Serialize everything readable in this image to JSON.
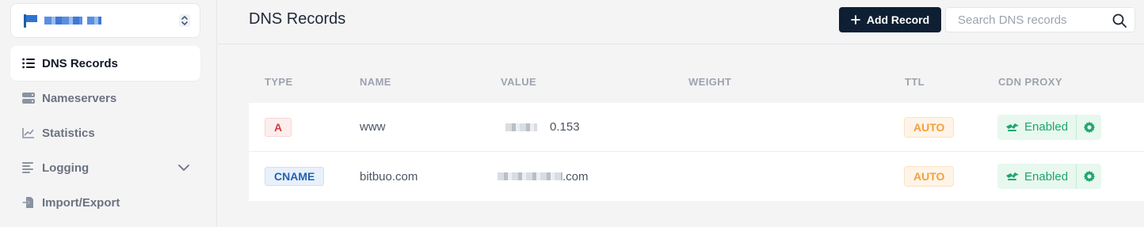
{
  "sidebar": {
    "site_selector": {
      "icon": "flag-icon"
    },
    "items": [
      {
        "label": "DNS Records",
        "icon": "list-icon",
        "active": true
      },
      {
        "label": "Nameservers",
        "icon": "server-icon"
      },
      {
        "label": "Statistics",
        "icon": "chart-icon"
      },
      {
        "label": "Logging",
        "icon": "log-icon",
        "expandable": true
      },
      {
        "label": "Import/Export",
        "icon": "import-export-icon"
      }
    ]
  },
  "header": {
    "title": "DNS Records",
    "add_button_label": "Add Record",
    "search_placeholder": "Search DNS records"
  },
  "table": {
    "columns": [
      "TYPE",
      "NAME",
      "VALUE",
      "WEIGHT",
      "TTL",
      "CDN PROXY"
    ],
    "rows": [
      {
        "type": "A",
        "name": "www",
        "value_suffix": "0.153",
        "weight": "",
        "ttl": "AUTO",
        "proxy": "Enabled"
      },
      {
        "type": "CNAME",
        "name": "bitbuo.com",
        "value_suffix": ".com",
        "weight": "",
        "ttl": "AUTO",
        "proxy": "Enabled"
      }
    ]
  },
  "colors": {
    "accent_dark": "#0f1f33",
    "type_a": "#d53b3b",
    "type_cname": "#2462ad",
    "ttl": "#f5a03a",
    "proxy_enabled": "#1ea66e"
  }
}
